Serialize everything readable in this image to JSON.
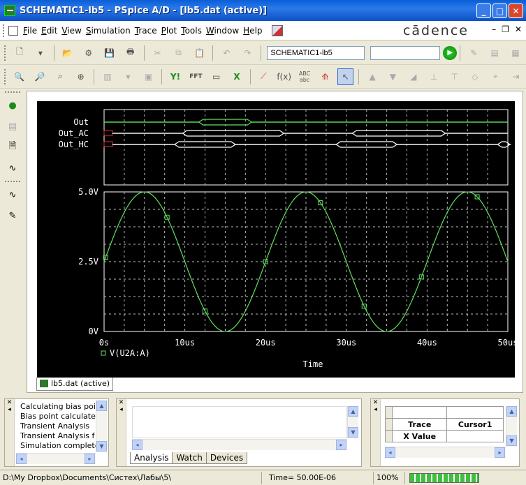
{
  "window": {
    "title": "SCHEMATIC1-lb5 - PSpice A/D  - [lb5.dat (active)]",
    "brand": "cādence"
  },
  "menu": {
    "items": [
      {
        "label": "File",
        "u": "F",
        "rest": "ile"
      },
      {
        "label": "Edit",
        "u": "E",
        "rest": "dit"
      },
      {
        "label": "View",
        "u": "V",
        "rest": "iew"
      },
      {
        "label": "Simulation",
        "u": "S",
        "rest": "imulation"
      },
      {
        "label": "Trace",
        "u": "T",
        "rest": "race"
      },
      {
        "label": "Plot",
        "u": "P",
        "rest": "lot"
      },
      {
        "label": "Tools",
        "u": "T",
        "rest": "ools"
      },
      {
        "label": "Window",
        "u": "W",
        "rest": "indow"
      },
      {
        "label": "Help",
        "u": "H",
        "rest": "elp"
      }
    ]
  },
  "toolbar": {
    "profile_value": "SCHEMATIC1-lb5",
    "search_value": "",
    "fft_label": "FFT",
    "abc_label": "ABC abc"
  },
  "plot": {
    "digital_labels": [
      "Out",
      "Out_AC",
      "Out_HC"
    ],
    "y_ticks": [
      "5.0V",
      "2.5V",
      "0V"
    ],
    "x_ticks": [
      "0s",
      "10us",
      "20us",
      "30us",
      "40us",
      "50us"
    ],
    "legend": "V(U2A:A)",
    "xlabel": "Time",
    "trace_color": "#5fe05f"
  },
  "chart_data": {
    "type": "line",
    "title": "",
    "xlabel": "Time",
    "ylabel": "",
    "xlim": [
      0,
      50
    ],
    "ylim": [
      0,
      5
    ],
    "x_unit": "us",
    "series": [
      {
        "name": "V(U2A:A)",
        "x": [
          0,
          2.5,
          5,
          7.5,
          10,
          12.5,
          15,
          17.5,
          20,
          22.5,
          25,
          27.5,
          30,
          32.5,
          35,
          37.5,
          40,
          42.5,
          45,
          47.5,
          50
        ],
        "values": [
          2.5,
          4.27,
          5.0,
          4.27,
          2.5,
          0.73,
          0.0,
          0.73,
          2.5,
          4.27,
          5.0,
          4.27,
          2.5,
          0.73,
          0.0,
          0.73,
          2.5,
          4.27,
          5.0,
          4.27,
          2.5
        ]
      }
    ],
    "markers_x": [
      0.2,
      7.8,
      12.5,
      20,
      26.8,
      32.2,
      39.3,
      46.2
    ],
    "digital_traces": [
      {
        "name": "Out",
        "high": [
          [
            12,
            18
          ]
        ]
      },
      {
        "name": "Out_AC",
        "high": [
          [
            10,
            22
          ],
          [
            31,
            42
          ]
        ]
      },
      {
        "name": "Out_HC",
        "high": [
          [
            9,
            16
          ],
          [
            29,
            36
          ],
          [
            49,
            50
          ]
        ]
      }
    ]
  },
  "tab": {
    "label": "lb5.dat (active)"
  },
  "output_log": {
    "lines": [
      "Calculating bias poi",
      "Bias point calculate",
      "Transient Analysis",
      "Transient Analysis f",
      "Simulation complete"
    ]
  },
  "bottom_tabs": [
    "Analysis",
    "Watch",
    "Devices"
  ],
  "probe": {
    "trace_header": "Trace",
    "cursor_header": "Cursor1",
    "xvalue_label": "X Value"
  },
  "status": {
    "path": "D:\\My Dropbox\\Documents\\Систех\\Лабы\\5\\",
    "time": "Time= 50.00E-06",
    "zoom": "100%"
  }
}
